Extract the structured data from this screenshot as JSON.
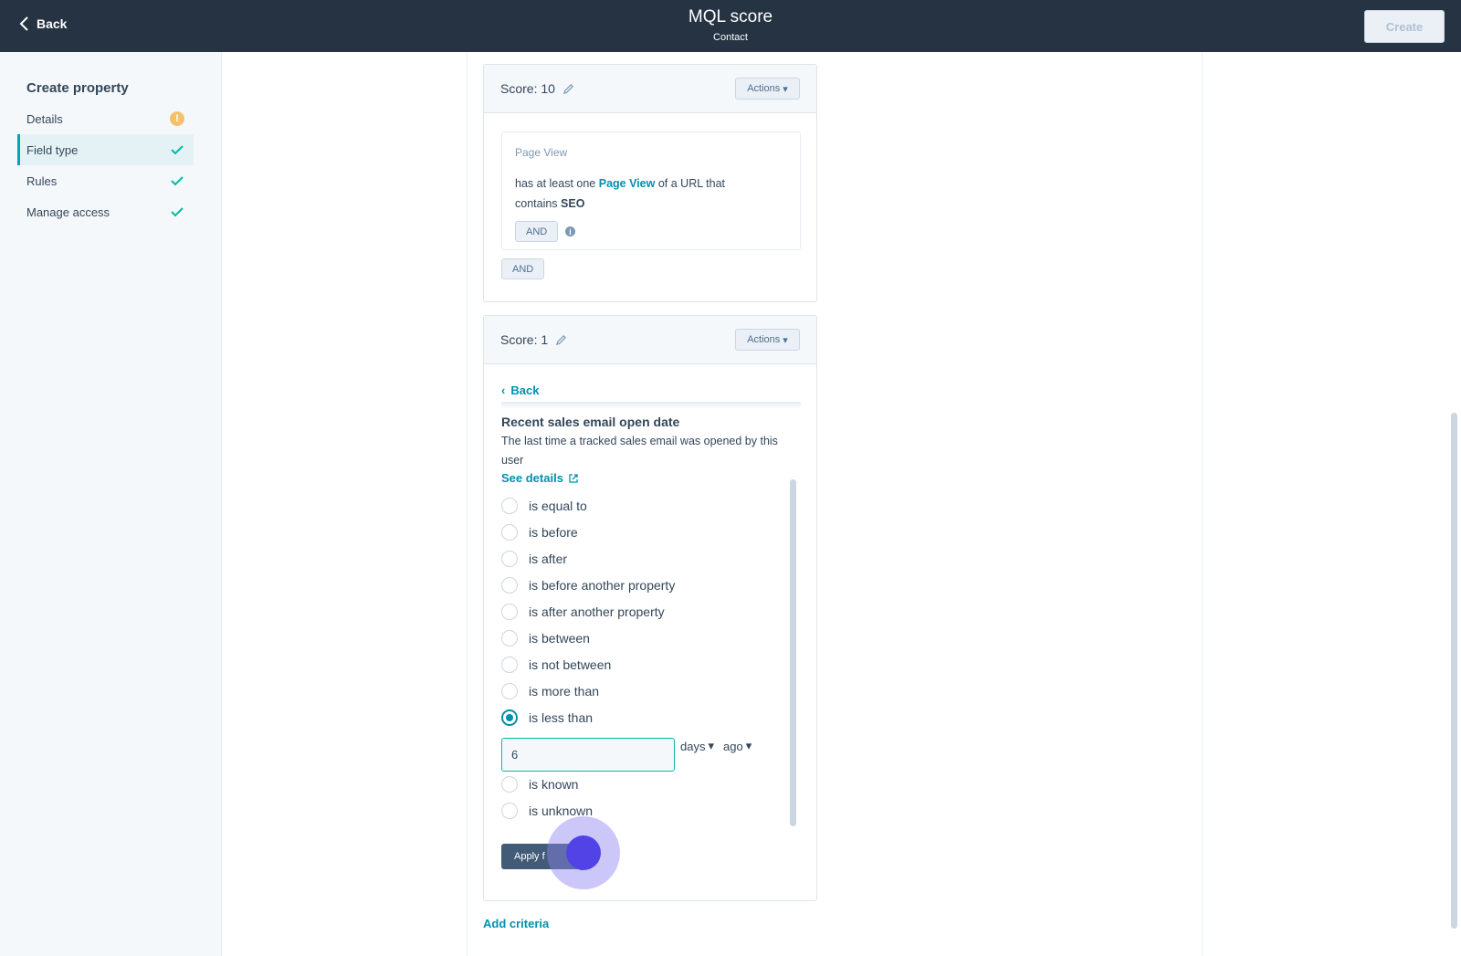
{
  "header": {
    "back_label": "Back",
    "title": "MQL score",
    "subtitle": "Contact",
    "create_label": "Create"
  },
  "sidebar": {
    "title": "Create property",
    "items": [
      {
        "label": "Details",
        "status": "warning"
      },
      {
        "label": "Field type",
        "status": "complete",
        "active": true
      },
      {
        "label": "Rules",
        "status": "complete"
      },
      {
        "label": "Manage access",
        "status": "complete"
      }
    ]
  },
  "score_group_1": {
    "label": "Score: 10",
    "actions_label": "Actions",
    "criterion": {
      "type_label": "Page View",
      "text_prefix": "has at least one",
      "link": "Page View",
      "text_middle": "of a URL that",
      "text_contains": "contains",
      "value": "SEO"
    },
    "and_inner_label": "AND",
    "and_outer_label": "AND"
  },
  "score_group_2": {
    "label": "Score: 1",
    "actions_label": "Actions",
    "back_label": "Back",
    "property_title": "Recent sales email open date",
    "property_description": "The last time a tracked sales email was opened by this user",
    "see_details_label": "See details",
    "options": [
      {
        "label": "is equal to",
        "checked": false
      },
      {
        "label": "is before",
        "checked": false
      },
      {
        "label": "is after",
        "checked": false
      },
      {
        "label": "is before another property",
        "checked": false
      },
      {
        "label": "is after another property",
        "checked": false
      },
      {
        "label": "is between",
        "checked": false
      },
      {
        "label": "is not between",
        "checked": false
      },
      {
        "label": "is more than",
        "checked": false
      },
      {
        "label": "is less than",
        "checked": true
      }
    ],
    "options_after": [
      {
        "label": "is known",
        "checked": false
      },
      {
        "label": "is unknown",
        "checked": false
      }
    ],
    "value_input": "6",
    "unit_dropdown": "days",
    "direction_dropdown": "ago",
    "apply_label": "Apply f"
  },
  "add_criteria_label": "Add criteria",
  "colors": {
    "header_bg": "#253342",
    "accent_teal": "#0091ae",
    "warning": "#f5c26b",
    "apply_bg": "#425b76"
  }
}
